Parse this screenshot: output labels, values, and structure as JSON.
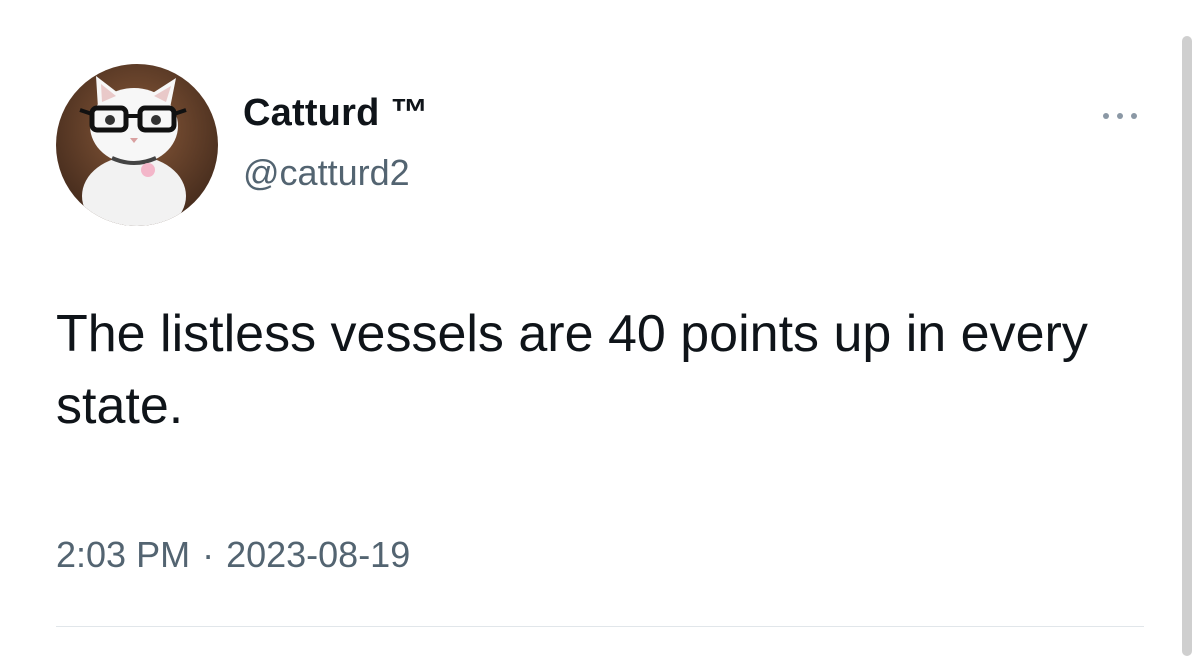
{
  "tweet": {
    "author": {
      "display_name": "Catturd ™",
      "handle": "@catturd2",
      "avatar_icon": "cat-with-glasses-avatar"
    },
    "more_icon": "more-horizontal-icon",
    "text": "The listless vessels are 40 points up in every state.",
    "time": "2:03 PM",
    "separator": "·",
    "date": "2023-08-19"
  },
  "colors": {
    "text_primary": "#0f1419",
    "text_secondary": "#536471",
    "divider": "#e1e6ea",
    "background": "#ffffff"
  }
}
